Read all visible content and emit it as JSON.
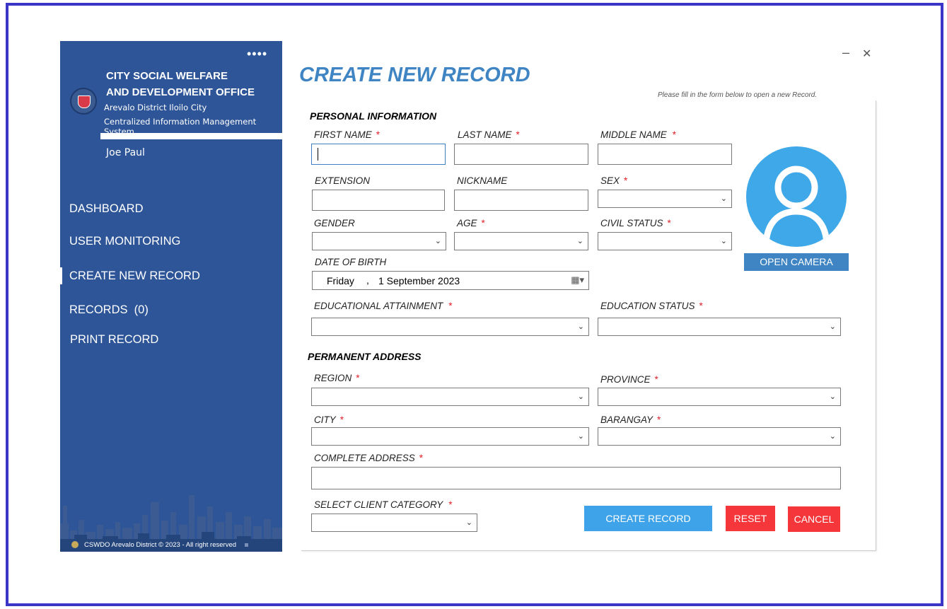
{
  "sidebar": {
    "menu_dots": "••••",
    "org_line1": "CITY SOCIAL WELFARE",
    "org_line2": "AND DEVELOPMENT OFFICE",
    "district": "Arevalo District Iloilo City",
    "system": "Centralized Information Management System",
    "username": "Joe Paul",
    "nav": [
      "DASHBOARD",
      "USER MONITORING",
      "CREATE NEW RECORD",
      "RECORDS  (0)",
      "PRINT RECORD"
    ],
    "footer": "CSWDO Arevalo District © 2023 - All right reserved",
    "bg_color": "#2e5597"
  },
  "window": {
    "minimize": "–",
    "close": "✕"
  },
  "page": {
    "title": "CREATE NEW RECORD",
    "hint": "Please fill in the form below to open a new Record."
  },
  "personal": {
    "section": "PERSONAL INFORMATION",
    "first_name": "FIRST NAME",
    "last_name": "LAST NAME",
    "middle_name": "MIDDLE NAME",
    "extension": "EXTENSION",
    "nickname": "NICKNAME",
    "sex": "SEX",
    "gender": "GENDER",
    "age": "AGE",
    "civil_status": "CIVIL STATUS",
    "dob": "DATE OF BIRTH",
    "dob_day": "Friday",
    "dob_comma": ",",
    "dob_date": "1 September 2023",
    "edu_attainment": "EDUCATIONAL ATTAINMENT",
    "edu_status": "EDUCATION STATUS"
  },
  "address": {
    "section": "PERMANENT ADDRESS",
    "region": "REGION",
    "province": "PROVINCE",
    "city": "CITY",
    "barangay": "BARANGAY",
    "complete": "COMPLETE ADDRESS",
    "client_category": "SELECT CLIENT CATEGORY"
  },
  "required_mark": "*",
  "buttons": {
    "open_camera": "OPEN CAMERA",
    "create": "CREATE RECORD",
    "reset": "RESET",
    "cancel": "CANCEL"
  },
  "colors": {
    "accent": "#3f84c3",
    "danger": "#f5363a",
    "border": "#3b36c7"
  },
  "icons": {
    "avatar": "user-silhouette",
    "calendar": "calendar-icon",
    "chevron": "chevron-down-icon"
  }
}
